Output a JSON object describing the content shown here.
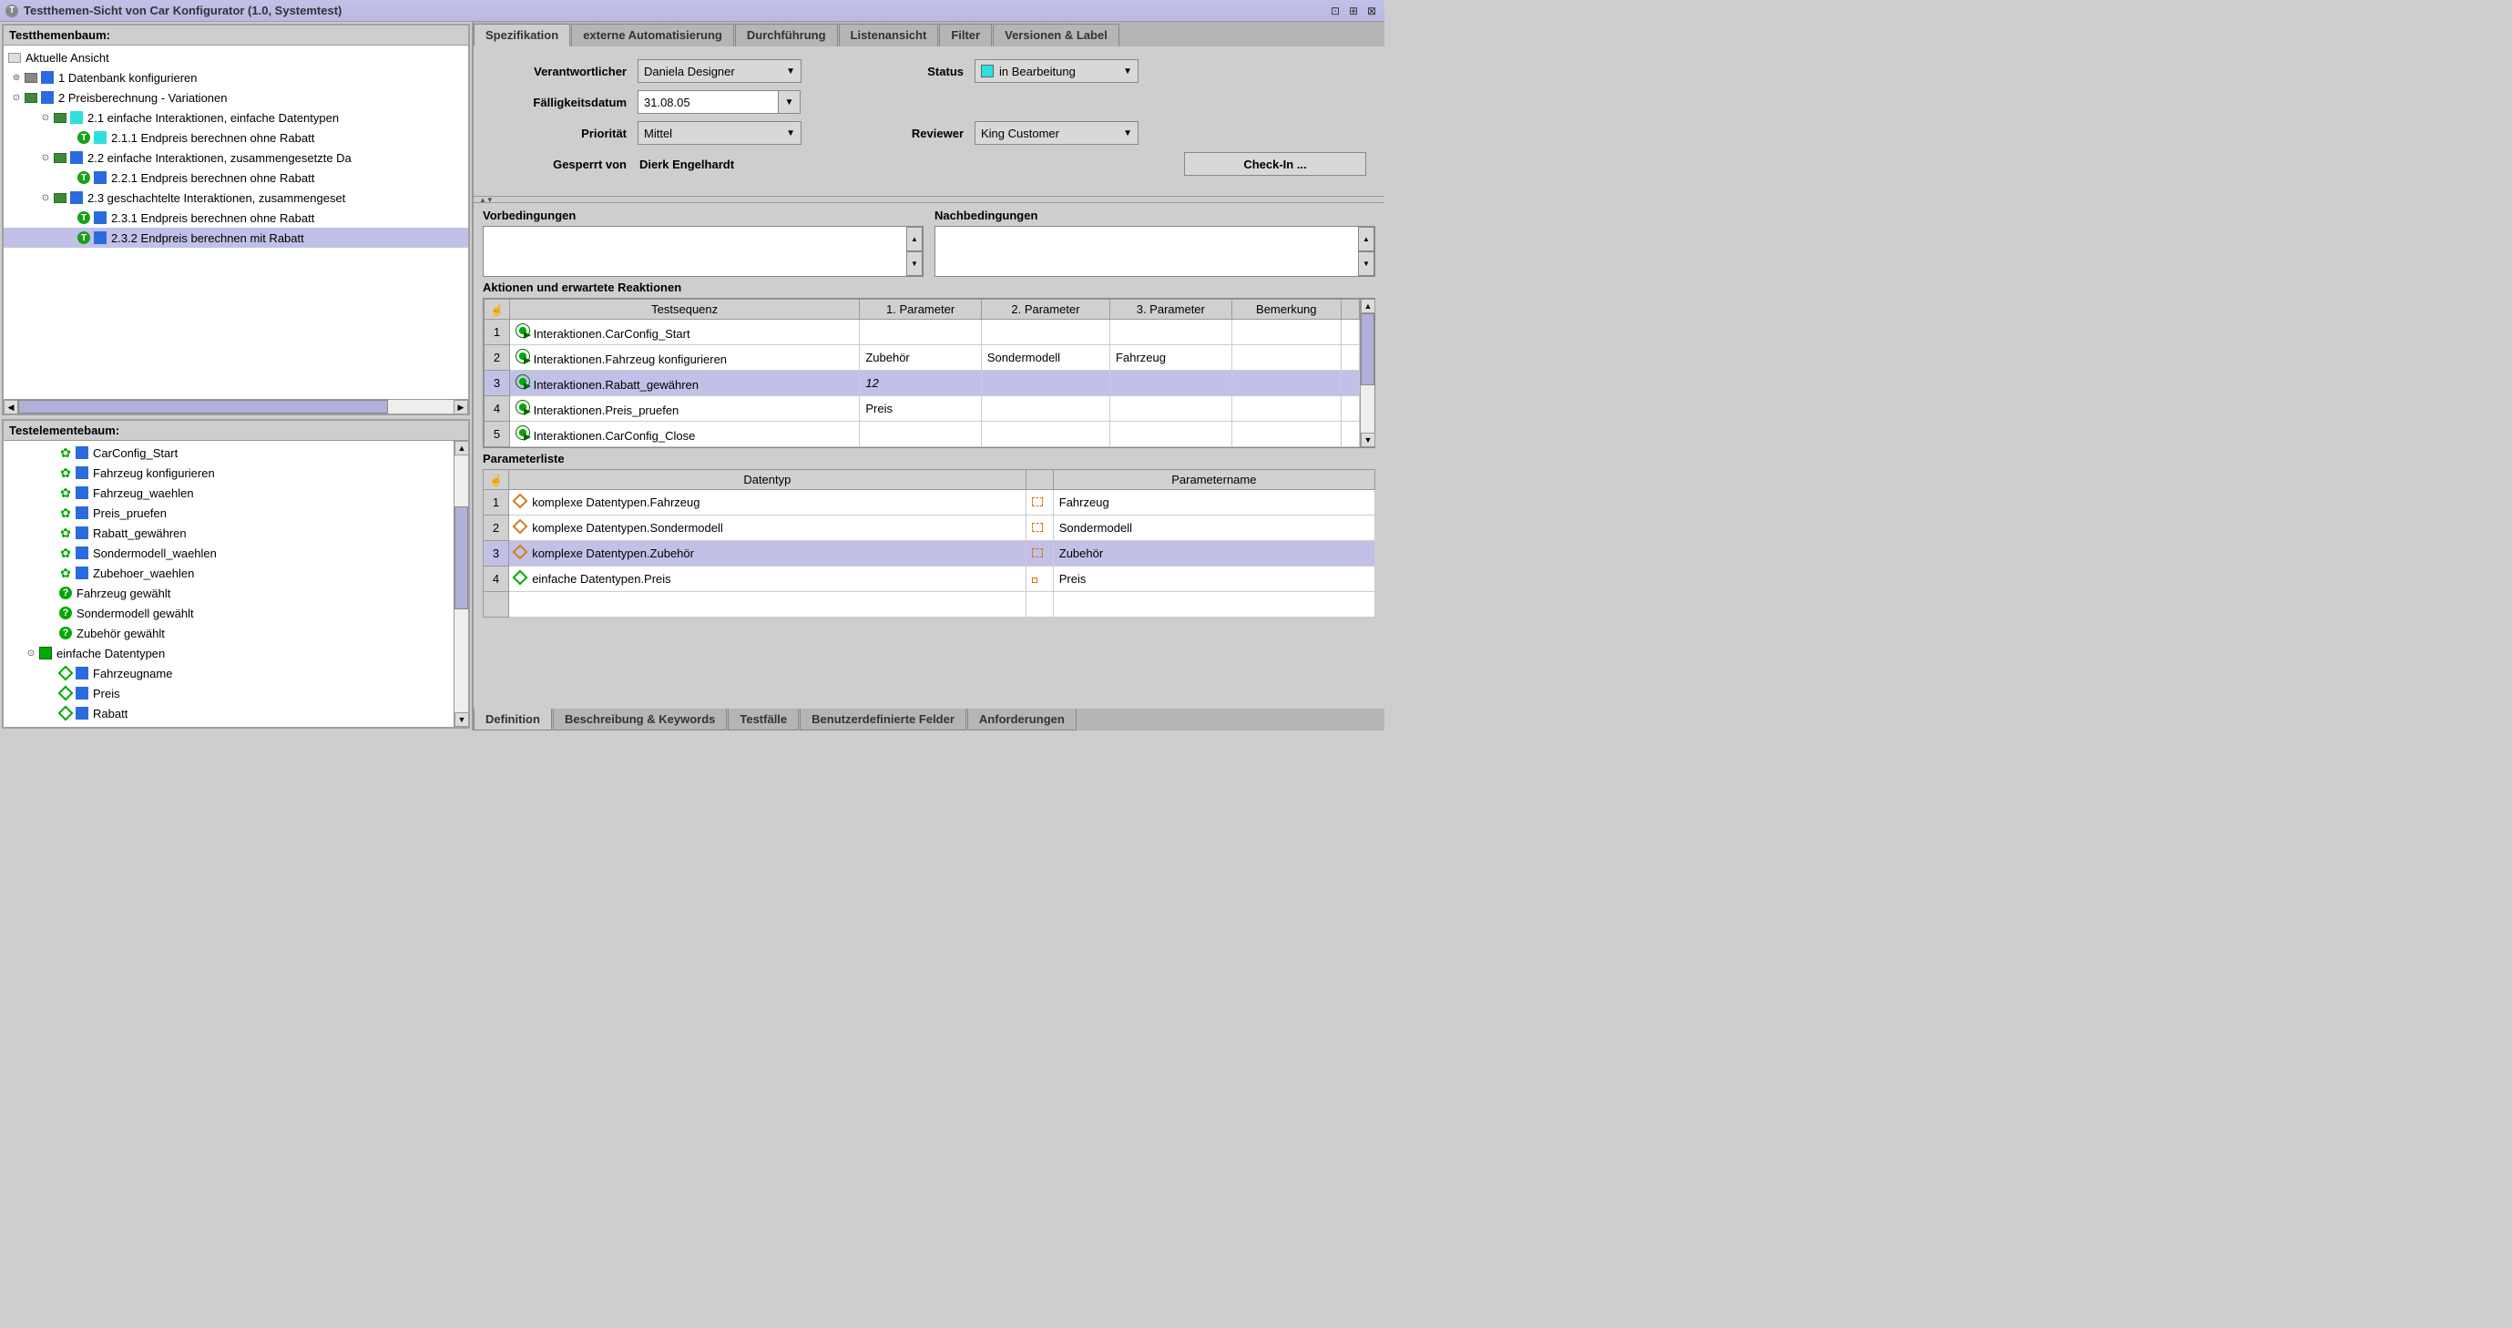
{
  "titlebar": {
    "title": "Testthemen-Sicht von Car Konfigurator (1.0, Systemtest)"
  },
  "tree1": {
    "header": "Testthemenbaum:",
    "root": "Aktuelle Ansicht",
    "n1": "1 Datenbank konfigurieren",
    "n2": "2 Preisberechnung - Variationen",
    "n21": "2.1 einfache Interaktionen, einfache Datentypen",
    "n211": "2.1.1 Endpreis berechnen ohne Rabatt",
    "n22": "2.2 einfache Interaktionen, zusammengesetzte Da",
    "n221": "2.2.1 Endpreis berechnen ohne Rabatt",
    "n23": "2.3 geschachtelte Interaktionen, zusammengeset",
    "n231": "2.3.1 Endpreis berechnen ohne Rabatt",
    "n232": "2.3.2 Endpreis berechnen mit Rabatt"
  },
  "tree2": {
    "header": "Testelementebaum:",
    "e1": "CarConfig_Start",
    "e2": "Fahrzeug konfigurieren",
    "e3": "Fahrzeug_waehlen",
    "e4": "Preis_pruefen",
    "e5": "Rabatt_gewähren",
    "e6": "Sondermodell_waehlen",
    "e7": "Zubehoer_waehlen",
    "e8": "Fahrzeug gewählt",
    "e9": "Sondermodell gewählt",
    "e10": "Zubehör gewählt",
    "e11": "einfache Datentypen",
    "e12": "Fahrzeugname",
    "e13": "Preis",
    "e14": "Rabatt"
  },
  "tabs_top": {
    "t1": "Spezifikation",
    "t2": "externe Automatisierung",
    "t3": "Durchführung",
    "t4": "Listenansicht",
    "t5": "Filter",
    "t6": "Versionen & Label"
  },
  "form": {
    "l_verantwortlicher": "Verantwortlicher",
    "v_verantwortlicher": "Daniela Designer",
    "l_status": "Status",
    "v_status": "in Bearbeitung",
    "l_faelligkeit": "Fälligkeitsdatum",
    "v_faelligkeit": "31.08.05",
    "l_prioritaet": "Priorität",
    "v_prioritaet": "Mittel",
    "l_reviewer": "Reviewer",
    "v_reviewer": "King Customer",
    "l_gesperrt": "Gesperrt von",
    "v_gesperrt": "Dierk Engelhardt",
    "btn_checkin": "Check-In ..."
  },
  "cond": {
    "l_vor": "Vorbedingungen",
    "l_nach": "Nachbedingungen"
  },
  "act": {
    "title": "Aktionen und erwartete Reaktionen",
    "h1": "Testsequenz",
    "h2": "1. Parameter",
    "h3": "2. Parameter",
    "h4": "3. Parameter",
    "h5": "Bemerkung",
    "r1_seq": "Interaktionen.CarConfig_Start",
    "r2_seq": "Interaktionen.Fahrzeug konfigurieren",
    "r2_p1": "Zubehör",
    "r2_p2": "Sondermodell",
    "r2_p3": "Fahrzeug",
    "r3_seq": "Interaktionen.Rabatt_gewähren",
    "r3_p1": "12",
    "r4_seq": "Interaktionen.Preis_pruefen",
    "r4_p1": "Preis",
    "r5_seq": "Interaktionen.CarConfig_Close"
  },
  "param": {
    "title": "Parameterliste",
    "h1": "Datentyp",
    "h2": "Parametername",
    "r1_d": "komplexe Datentypen.Fahrzeug",
    "r1_n": "Fahrzeug",
    "r2_d": "komplexe Datentypen.Sondermodell",
    "r2_n": "Sondermodell",
    "r3_d": "komplexe Datentypen.Zubehör",
    "r3_n": "Zubehör",
    "r4_d": "einfache Datentypen.Preis",
    "r4_n": "Preis"
  },
  "tabs_bottom": {
    "b1": "Definition",
    "b2": "Beschreibung & Keywords",
    "b3": "Testfälle",
    "b4": "Benutzerdefinierte Felder",
    "b5": "Anforderungen"
  }
}
